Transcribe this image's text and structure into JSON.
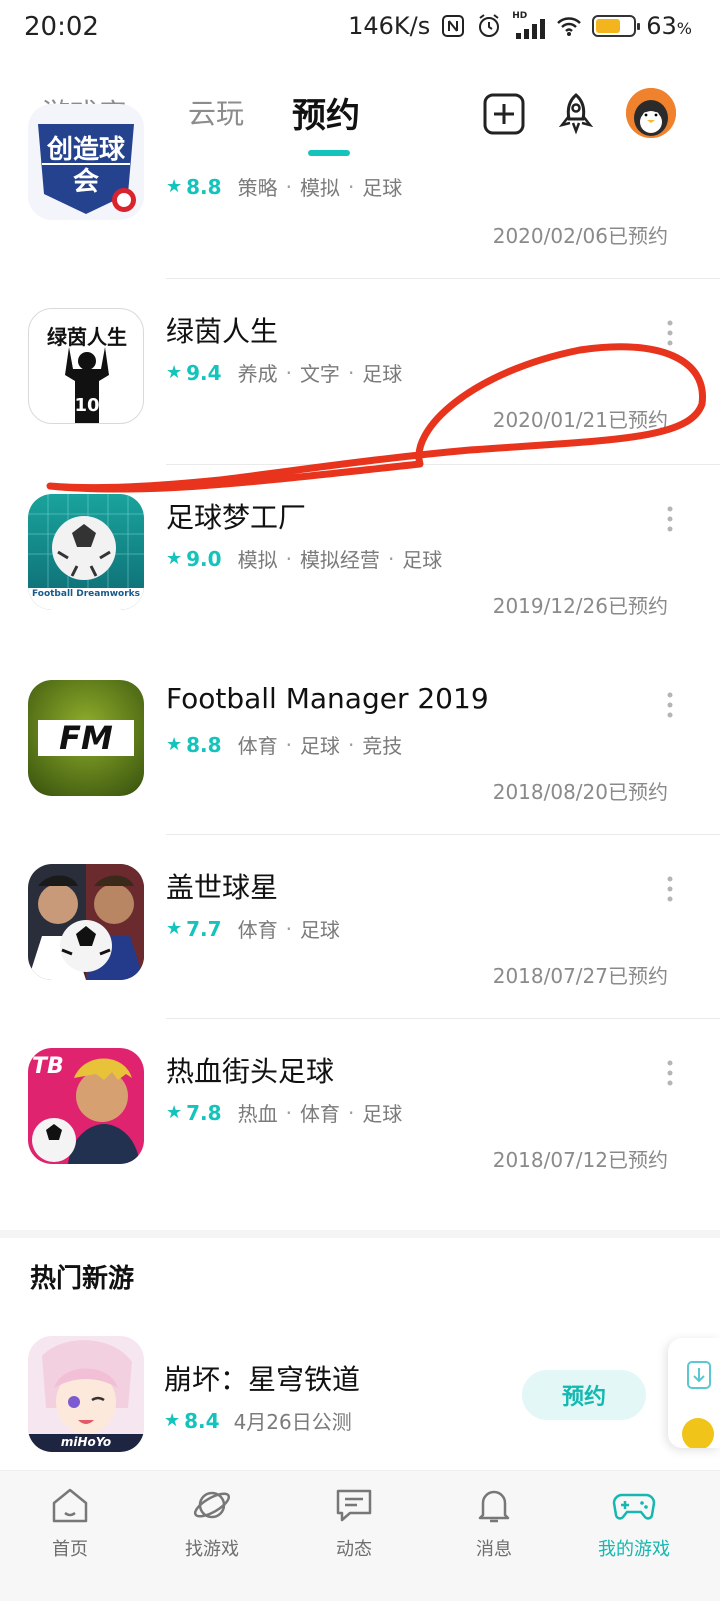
{
  "status_bar": {
    "time": "20:02",
    "speed": "146K/s",
    "battery": "63",
    "battery_unit": "%",
    "hd": "HD"
  },
  "top_nav": {
    "tabs": [
      "游戏库",
      "云玩",
      "预约"
    ],
    "active_tab": "预约"
  },
  "reservations": [
    {
      "partial_icon_text": "创造球会",
      "rating": "8.8",
      "tags": [
        "策略",
        "模拟",
        "足球"
      ],
      "date": "2020/02/06已预约"
    },
    {
      "title": "绿茵人生",
      "icon_text": "绿茵人生",
      "icon_number": "10",
      "rating": "9.4",
      "tags": [
        "养成",
        "文字",
        "足球"
      ],
      "date": "2020/01/21已预约"
    },
    {
      "title": "足球梦工厂",
      "icon_text": "Football Dreamworks",
      "rating": "9.0",
      "tags": [
        "模拟",
        "模拟经营",
        "足球"
      ],
      "date": "2019/12/26已预约"
    },
    {
      "title": "Football Manager 2019",
      "icon_text": "FM",
      "rating": "8.8",
      "tags": [
        "体育",
        "足球",
        "竞技"
      ],
      "date": "2018/08/20已预约"
    },
    {
      "title": "盖世球星",
      "rating": "7.7",
      "tags": [
        "体育",
        "足球"
      ],
      "date": "2018/07/27已预约"
    },
    {
      "title": "热血街头足球",
      "icon_text": "TB",
      "rating": "7.8",
      "tags": [
        "热血",
        "体育",
        "足球"
      ],
      "date": "2018/07/12已预约"
    }
  ],
  "hot_section": {
    "title": "热门新游",
    "game": {
      "name": "崩坏：星穹铁道",
      "icon_text": "miHoYo",
      "rating": "8.4",
      "launch": "4月26日公测",
      "button": "预约"
    }
  },
  "bottom_nav": [
    {
      "label": "首页",
      "icon": "home-icon"
    },
    {
      "label": "找游戏",
      "icon": "planet-icon"
    },
    {
      "label": "动态",
      "icon": "message-icon"
    },
    {
      "label": "消息",
      "icon": "bell-icon"
    },
    {
      "label": "我的游戏",
      "icon": "gamepad-icon",
      "active": true
    }
  ],
  "colors": {
    "accent": "#14c4bc",
    "annotation": "#e8341c"
  }
}
